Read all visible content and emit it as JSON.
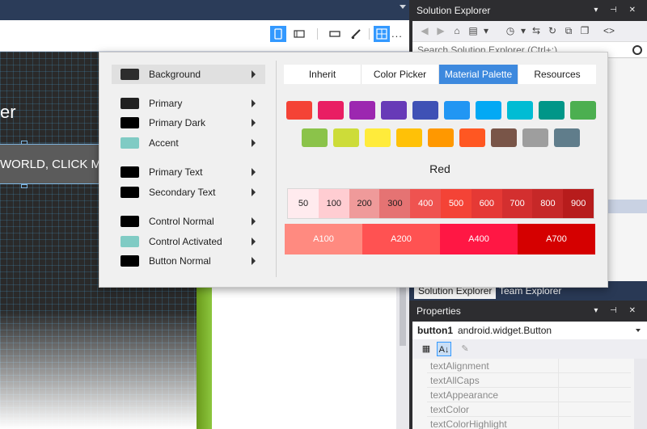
{
  "designer": {
    "more_label": "...",
    "canvas_title": "er",
    "canvas_button_text": "WORLD, CLICK ME"
  },
  "toolbar_icons": [
    "phone-icon",
    "tablet-icon",
    "ruler-icon",
    "brush-icon",
    "layout-icon"
  ],
  "solution_explorer": {
    "title": "Solution Explorer",
    "search_placeholder": "Search Solution Explorer (Ctrl+;)",
    "title_buttons": "▾ ⊣ ✕"
  },
  "bottom_tabs": {
    "solution_explorer": "Solution Explorer",
    "team_explorer": "Team Explorer"
  },
  "properties": {
    "title": "Properties",
    "object_name": "button1",
    "object_type": "android.widget.Button",
    "rows": [
      "textAlignment",
      "textAllCaps",
      "textAppearance",
      "textColor",
      "textColorHighlight"
    ]
  },
  "popup": {
    "resources": [
      {
        "label": "Background",
        "color": "#2d2d2d"
      },
      {
        "label": "Primary",
        "color": "#212121"
      },
      {
        "label": "Primary Dark",
        "color": "#000000"
      },
      {
        "label": "Accent",
        "color": "#80cbc4"
      },
      {
        "label": "Primary Text",
        "color": "#000000"
      },
      {
        "label": "Secondary Text",
        "color": "#000000"
      },
      {
        "label": "Control Normal",
        "color": "#000000"
      },
      {
        "label": "Control Activated",
        "color": "#80cbc4"
      },
      {
        "label": "Button Normal",
        "color": "#000000"
      }
    ],
    "tabs": [
      "Inherit",
      "Color Picker",
      "Material Palette",
      "Resources"
    ],
    "active_tab": "Material Palette",
    "palette_row1": [
      "#f44336",
      "#e91e63",
      "#9c27b0",
      "#673ab7",
      "#3f51b5",
      "#2196f3",
      "#03a9f4",
      "#00bcd4",
      "#009688",
      "#4caf50"
    ],
    "palette_row2": [
      "#8bc34a",
      "#cddc39",
      "#ffeb3b",
      "#ffc107",
      "#ff9800",
      "#ff5722",
      "#795548",
      "#9e9e9e",
      "#607d8b"
    ],
    "selected_color_name": "Red",
    "shades": [
      {
        "label": "50",
        "color": "#ffebee",
        "text": "#1e1e1e"
      },
      {
        "label": "100",
        "color": "#ffcdd2",
        "text": "#1e1e1e"
      },
      {
        "label": "200",
        "color": "#ef9a9a",
        "text": "#1e1e1e"
      },
      {
        "label": "300",
        "color": "#e57373",
        "text": "#1e1e1e"
      },
      {
        "label": "400",
        "color": "#ef5350",
        "text": "#ffffff"
      },
      {
        "label": "500",
        "color": "#f44336",
        "text": "#ffffff"
      },
      {
        "label": "600",
        "color": "#e53935",
        "text": "#ffffff"
      },
      {
        "label": "700",
        "color": "#d32f2f",
        "text": "#ffffff"
      },
      {
        "label": "800",
        "color": "#c62828",
        "text": "#ffffff"
      },
      {
        "label": "900",
        "color": "#b71c1c",
        "text": "#ffffff"
      }
    ],
    "accents": [
      {
        "label": "A100",
        "color": "#ff8a80"
      },
      {
        "label": "A200",
        "color": "#ff5252"
      },
      {
        "label": "A400",
        "color": "#ff1744"
      },
      {
        "label": "A700",
        "color": "#d50000"
      }
    ]
  }
}
